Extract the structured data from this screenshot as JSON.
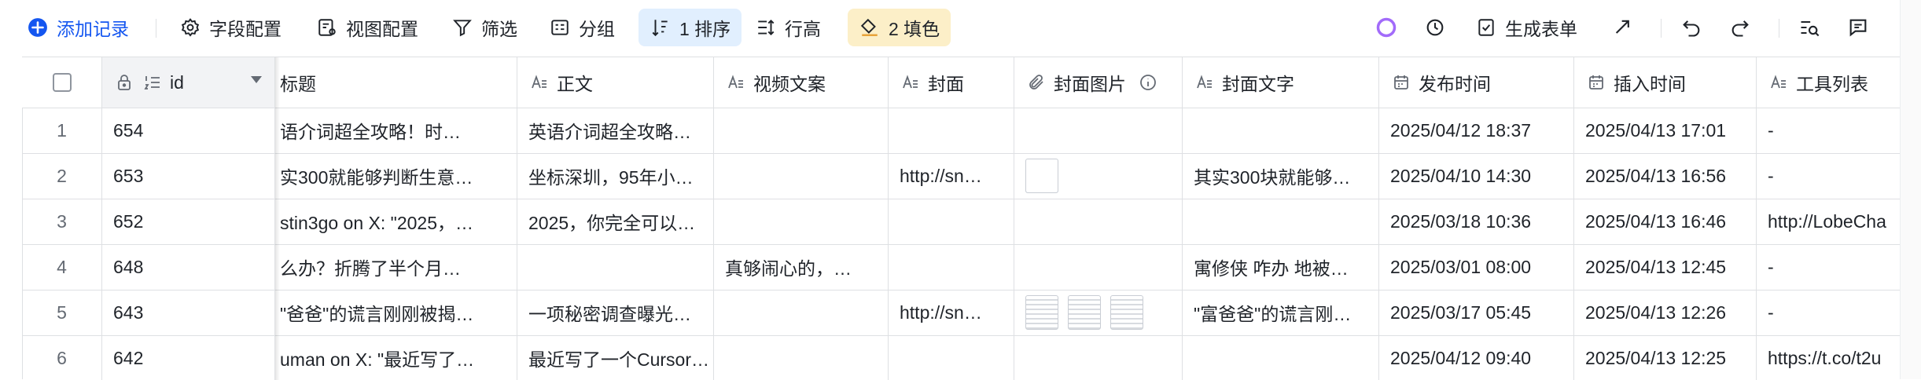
{
  "toolbar": {
    "add_record": "添加记录",
    "field_config": "字段配置",
    "view_config": "视图配置",
    "filter": "筛选",
    "group": "分组",
    "sort": "1 排序",
    "row_height": "行高",
    "fill": "2 填色",
    "generate_form": "生成表单"
  },
  "columns": {
    "id": "id",
    "title": "标题",
    "body": "正文",
    "video_copy": "视频文案",
    "cover": "封面",
    "cover_image": "封面图片",
    "cover_text": "封面文字",
    "publish_time": "发布时间",
    "insert_time": "插入时间",
    "tool_list": "工具列表"
  },
  "rows": [
    {
      "num": "1",
      "id": "654",
      "title": "语介词超全攻略！时…",
      "body": "英语介词超全攻略…",
      "video": "",
      "cover": "",
      "cover_text": "",
      "publish": "2025/04/12  18:37",
      "insert": "2025/04/13 17:01",
      "tools": "-"
    },
    {
      "num": "2",
      "id": "653",
      "title": "实300就能够判断生意…",
      "body": "坐标深圳，95年小…",
      "video": "",
      "cover": "http://sn…",
      "cover_text": "其实300块就能够…",
      "publish": "2025/04/10  14:30",
      "insert": "2025/04/13 16:56",
      "tools": "-"
    },
    {
      "num": "3",
      "id": "652",
      "title": "stin3go on X: \"2025，…",
      "body": "2025，你完全可以…",
      "video": "",
      "cover": "",
      "cover_text": "",
      "publish": "2025/03/18  10:36",
      "insert": "2025/04/13 16:46",
      "tools": "http://LobeCha"
    },
    {
      "num": "4",
      "id": "648",
      "title": "么办？折腾了半个月…",
      "body": "",
      "video": "真够闹心的，…",
      "cover": "",
      "cover_text": "寓修侠 咋办 地被…",
      "publish": "2025/03/01  08:00",
      "insert": "2025/04/13 12:45",
      "tools": "-"
    },
    {
      "num": "5",
      "id": "643",
      "title": "\"爸爸\"的谎言刚刚被揭…",
      "body": "一项秘密调查曝光…",
      "video": "",
      "cover": "http://sn…",
      "cover_text": "\"富爸爸\"的谎言刚…",
      "publish": "2025/03/17  05:45",
      "insert": "2025/04/13 12:26",
      "tools": "-"
    },
    {
      "num": "6",
      "id": "642",
      "title": "uman on X: \"最近写了…",
      "body": "最近写了一个Cursor…",
      "video": "",
      "cover": "",
      "cover_text": "",
      "publish": "2025/04/12  09:40",
      "insert": "2025/04/13 12:25",
      "tools": "https://t.co/t2u"
    }
  ],
  "colors": {
    "accent": "#1456f0",
    "sort_bg": "#e1effe",
    "fill_bg": "#fcefc8",
    "border": "#dee0e3"
  }
}
